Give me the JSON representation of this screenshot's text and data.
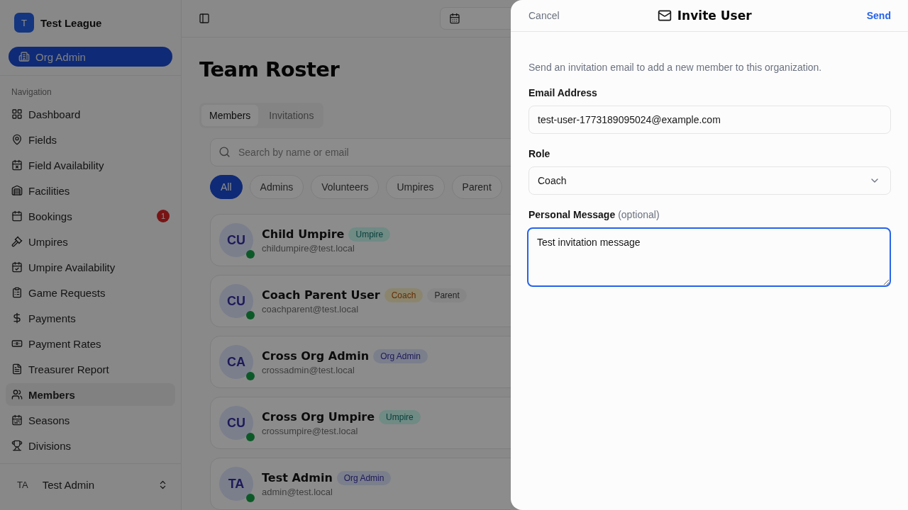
{
  "sidebar": {
    "org": {
      "initial": "T",
      "name": "Test League"
    },
    "role_button": "Org Admin",
    "section_label": "Navigation",
    "items": [
      {
        "label": "Dashboard",
        "selected": false
      },
      {
        "label": "Fields",
        "selected": false
      },
      {
        "label": "Field Availability",
        "selected": false
      },
      {
        "label": "Facilities",
        "selected": false
      },
      {
        "label": "Bookings",
        "selected": false,
        "badge": "1"
      },
      {
        "label": "Umpires",
        "selected": false
      },
      {
        "label": "Umpire Availability",
        "selected": false
      },
      {
        "label": "Game Requests",
        "selected": false
      },
      {
        "label": "Payments",
        "selected": false
      },
      {
        "label": "Payment Rates",
        "selected": false
      },
      {
        "label": "Treasurer Report",
        "selected": false
      },
      {
        "label": "Members",
        "selected": true
      },
      {
        "label": "Seasons",
        "selected": false
      },
      {
        "label": "Divisions",
        "selected": false
      }
    ],
    "user": {
      "initials": "TA",
      "name": "Test Admin"
    }
  },
  "main": {
    "title": "Team Roster",
    "tabs": [
      {
        "label": "Members",
        "selected": true
      },
      {
        "label": "Invitations",
        "selected": false
      }
    ],
    "search": {
      "placeholder": "Search by name or email"
    },
    "filters": [
      {
        "label": "All",
        "selected": true
      },
      {
        "label": "Admins",
        "selected": false
      },
      {
        "label": "Volunteers",
        "selected": false
      },
      {
        "label": "Umpires",
        "selected": false
      },
      {
        "label": "Parent",
        "selected": false
      }
    ],
    "members": [
      {
        "initials": "CU",
        "name": "Child Umpire",
        "email": "childumpire@test.local",
        "online": true,
        "roles": [
          {
            "label": "Umpire",
            "kind": "umpire"
          }
        ]
      },
      {
        "initials": "CU",
        "name": "Coach Parent User",
        "email": "coachparent@test.local",
        "online": true,
        "roles": [
          {
            "label": "Coach",
            "kind": "coach"
          },
          {
            "label": "Parent",
            "kind": "parent"
          }
        ]
      },
      {
        "initials": "CA",
        "name": "Cross Org Admin",
        "email": "crossadmin@test.local",
        "online": true,
        "roles": [
          {
            "label": "Org Admin",
            "kind": "admin"
          }
        ]
      },
      {
        "initials": "CU",
        "name": "Cross Org Umpire",
        "email": "crossumpire@test.local",
        "online": true,
        "roles": [
          {
            "label": "Umpire",
            "kind": "umpire"
          }
        ]
      },
      {
        "initials": "TA",
        "name": "Test Admin",
        "email": "admin@test.local",
        "online": true,
        "roles": [
          {
            "label": "Org Admin",
            "kind": "admin"
          }
        ]
      }
    ]
  },
  "sheet": {
    "cancel": "Cancel",
    "title": "Invite User",
    "send": "Send",
    "description": "Send an invitation email to add a new member to this organization.",
    "email": {
      "label": "Email Address",
      "value": "test-user-1773189095024@example.com"
    },
    "role": {
      "label": "Role",
      "value": "Coach"
    },
    "message": {
      "label": "Personal Message",
      "hint": "(optional)",
      "value": "Test invitation message",
      "focused": true
    }
  }
}
